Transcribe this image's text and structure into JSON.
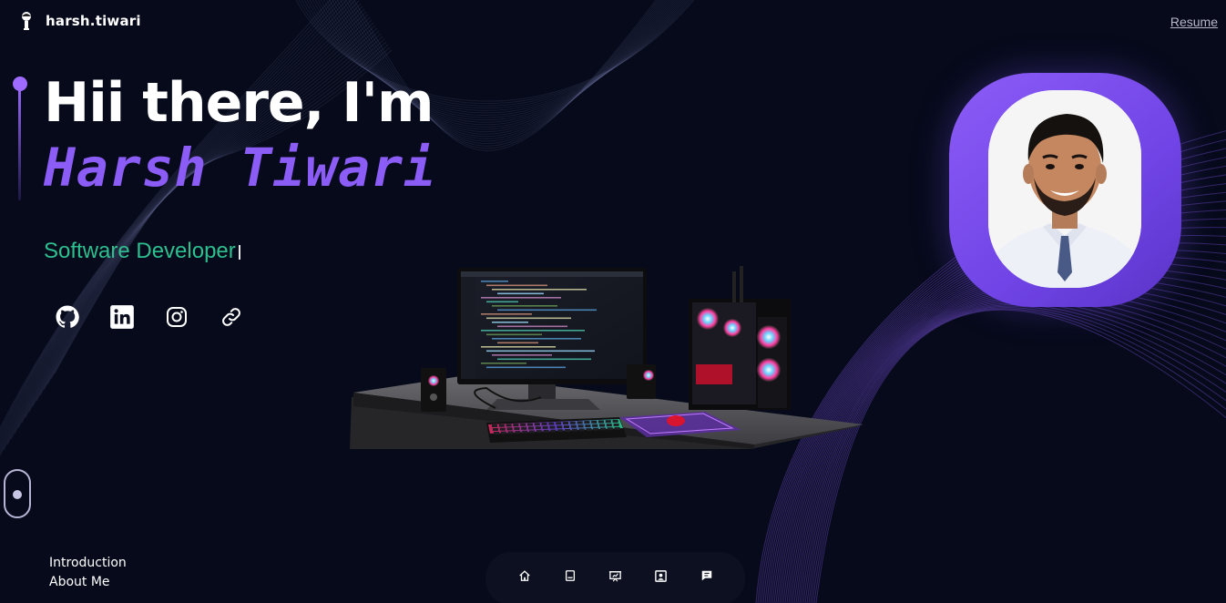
{
  "header": {
    "logo_text": "harsh.tiwari",
    "resume_label": "Resume"
  },
  "hero": {
    "greeting": "Hii there, I'm",
    "name": "Harsh Tiwari",
    "role": "Software Developer"
  },
  "socials": [
    {
      "icon": "github-icon"
    },
    {
      "icon": "linkedin-icon"
    },
    {
      "icon": "instagram-icon"
    },
    {
      "icon": "link-icon"
    }
  ],
  "section_nav": {
    "items": [
      "Introduction",
      "About Me"
    ]
  },
  "dock": {
    "items": [
      {
        "icon": "home-icon"
      },
      {
        "icon": "book-icon"
      },
      {
        "icon": "presentation-icon"
      },
      {
        "icon": "contact-card-icon"
      },
      {
        "icon": "message-icon"
      }
    ]
  },
  "colors": {
    "background": "#060a1a",
    "accent": "#8b5cf6",
    "role_green": "#2ebf8f"
  }
}
